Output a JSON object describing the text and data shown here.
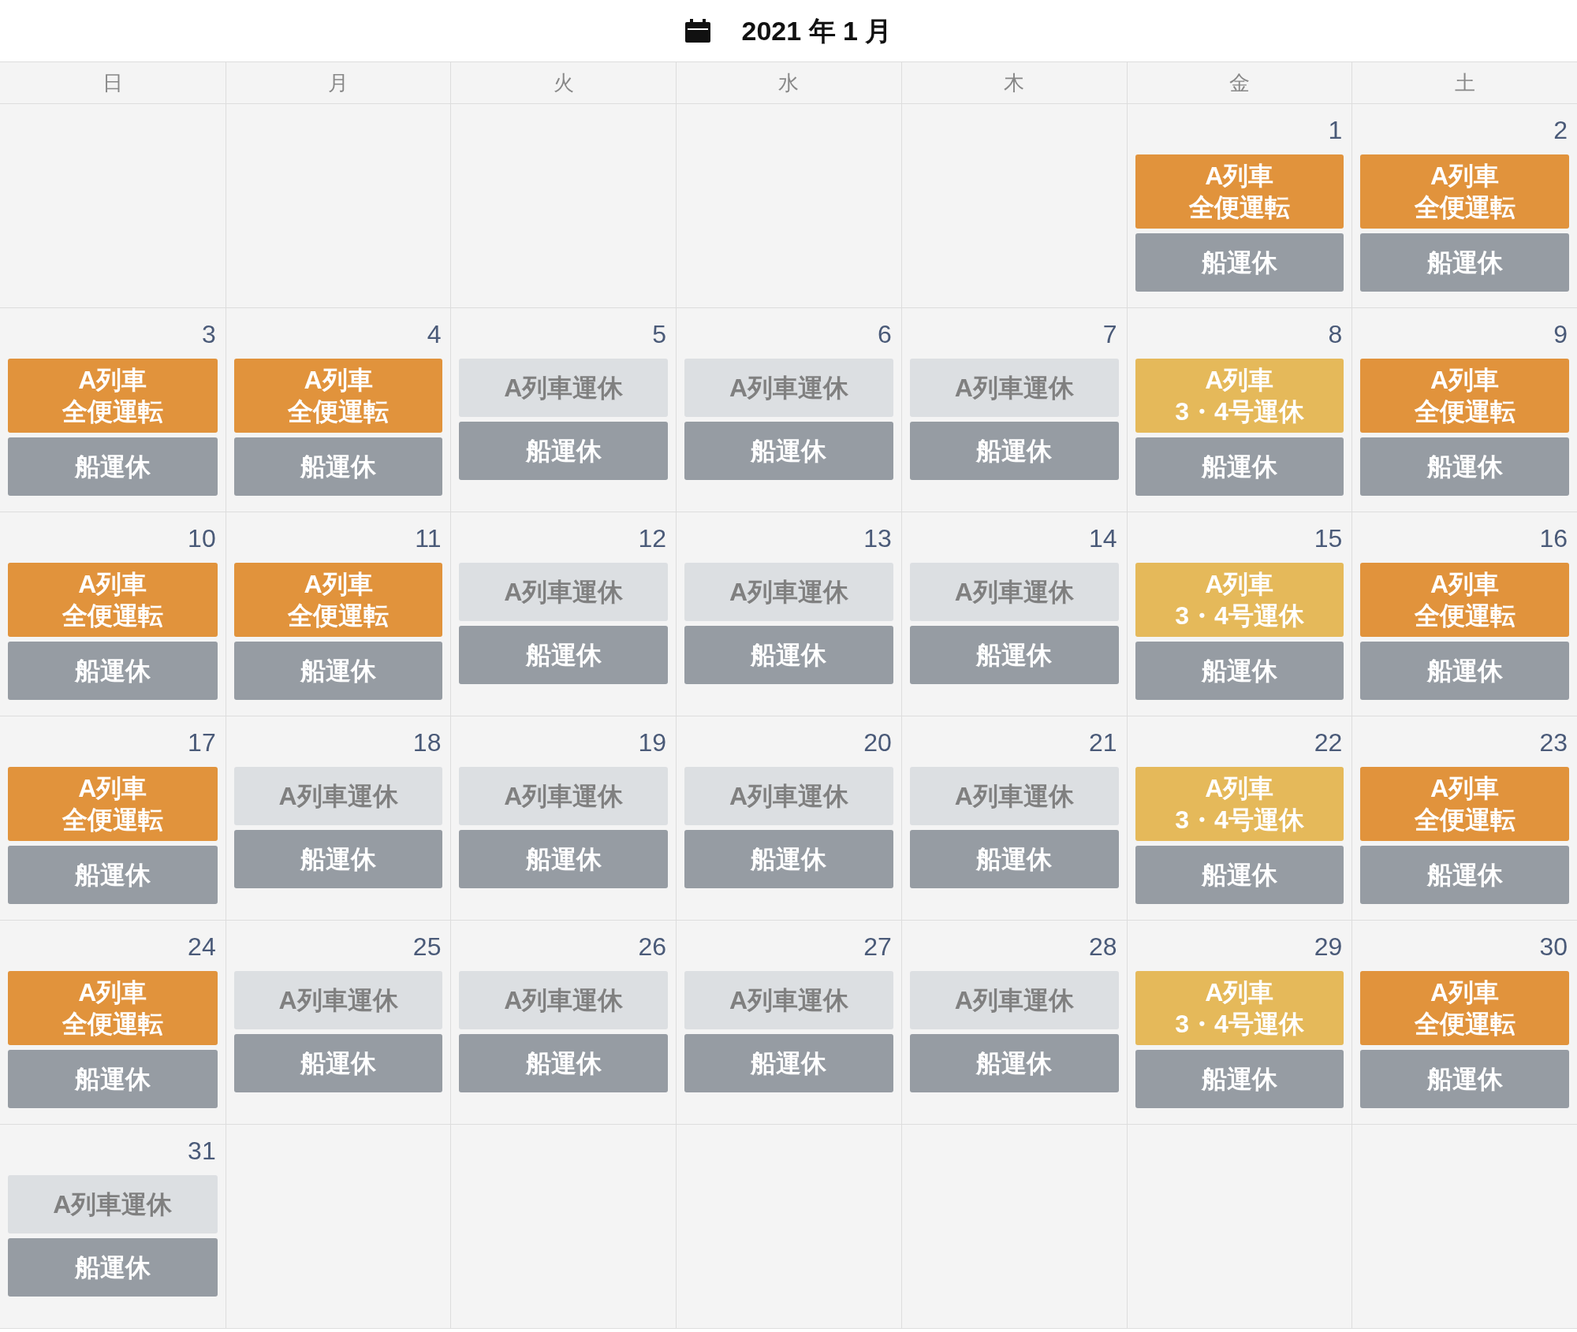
{
  "title": "2021 年 1 月",
  "weekdays": [
    "日",
    "月",
    "火",
    "水",
    "木",
    "金",
    "土"
  ],
  "weeks": [
    {
      "fri": {
        "day": "1",
        "events": [
          {
            "kind": "run",
            "lines": [
              "A列車",
              "全便運転"
            ]
          },
          {
            "kind": "ship",
            "lines": [
              "船運休"
            ]
          }
        ]
      },
      "sat": {
        "day": "2",
        "events": [
          {
            "kind": "run",
            "lines": [
              "A列車",
              "全便運転"
            ]
          },
          {
            "kind": "ship",
            "lines": [
              "船運休"
            ]
          }
        ]
      }
    },
    {
      "sun": {
        "day": "3",
        "events": [
          {
            "kind": "run",
            "lines": [
              "A列車",
              "全便運転"
            ]
          },
          {
            "kind": "ship",
            "lines": [
              "船運休"
            ]
          }
        ]
      },
      "mon": {
        "day": "4",
        "events": [
          {
            "kind": "run",
            "lines": [
              "A列車",
              "全便運転"
            ]
          },
          {
            "kind": "ship",
            "lines": [
              "船運休"
            ]
          }
        ]
      },
      "tue": {
        "day": "5",
        "events": [
          {
            "kind": "halt",
            "lines": [
              "A列車運休"
            ]
          },
          {
            "kind": "ship",
            "lines": [
              "船運休"
            ]
          }
        ]
      },
      "wed": {
        "day": "6",
        "events": [
          {
            "kind": "halt",
            "lines": [
              "A列車運休"
            ]
          },
          {
            "kind": "ship",
            "lines": [
              "船運休"
            ]
          }
        ]
      },
      "thu": {
        "day": "7",
        "events": [
          {
            "kind": "halt",
            "lines": [
              "A列車運休"
            ]
          },
          {
            "kind": "ship",
            "lines": [
              "船運休"
            ]
          }
        ]
      },
      "fri": {
        "day": "8",
        "events": [
          {
            "kind": "partial",
            "lines": [
              "A列車",
              "3・4号運休"
            ]
          },
          {
            "kind": "ship",
            "lines": [
              "船運休"
            ]
          }
        ]
      },
      "sat": {
        "day": "9",
        "events": [
          {
            "kind": "run",
            "lines": [
              "A列車",
              "全便運転"
            ]
          },
          {
            "kind": "ship",
            "lines": [
              "船運休"
            ]
          }
        ]
      }
    },
    {
      "sun": {
        "day": "10",
        "events": [
          {
            "kind": "run",
            "lines": [
              "A列車",
              "全便運転"
            ]
          },
          {
            "kind": "ship",
            "lines": [
              "船運休"
            ]
          }
        ]
      },
      "mon": {
        "day": "11",
        "events": [
          {
            "kind": "run",
            "lines": [
              "A列車",
              "全便運転"
            ]
          },
          {
            "kind": "ship",
            "lines": [
              "船運休"
            ]
          }
        ]
      },
      "tue": {
        "day": "12",
        "events": [
          {
            "kind": "halt",
            "lines": [
              "A列車運休"
            ]
          },
          {
            "kind": "ship",
            "lines": [
              "船運休"
            ]
          }
        ]
      },
      "wed": {
        "day": "13",
        "events": [
          {
            "kind": "halt",
            "lines": [
              "A列車運休"
            ]
          },
          {
            "kind": "ship",
            "lines": [
              "船運休"
            ]
          }
        ]
      },
      "thu": {
        "day": "14",
        "events": [
          {
            "kind": "halt",
            "lines": [
              "A列車運休"
            ]
          },
          {
            "kind": "ship",
            "lines": [
              "船運休"
            ]
          }
        ]
      },
      "fri": {
        "day": "15",
        "events": [
          {
            "kind": "partial",
            "lines": [
              "A列車",
              "3・4号運休"
            ]
          },
          {
            "kind": "ship",
            "lines": [
              "船運休"
            ]
          }
        ]
      },
      "sat": {
        "day": "16",
        "events": [
          {
            "kind": "run",
            "lines": [
              "A列車",
              "全便運転"
            ]
          },
          {
            "kind": "ship",
            "lines": [
              "船運休"
            ]
          }
        ]
      }
    },
    {
      "sun": {
        "day": "17",
        "events": [
          {
            "kind": "run",
            "lines": [
              "A列車",
              "全便運転"
            ]
          },
          {
            "kind": "ship",
            "lines": [
              "船運休"
            ]
          }
        ]
      },
      "mon": {
        "day": "18",
        "events": [
          {
            "kind": "halt",
            "lines": [
              "A列車運休"
            ]
          },
          {
            "kind": "ship",
            "lines": [
              "船運休"
            ]
          }
        ]
      },
      "tue": {
        "day": "19",
        "events": [
          {
            "kind": "halt",
            "lines": [
              "A列車運休"
            ]
          },
          {
            "kind": "ship",
            "lines": [
              "船運休"
            ]
          }
        ]
      },
      "wed": {
        "day": "20",
        "events": [
          {
            "kind": "halt",
            "lines": [
              "A列車運休"
            ]
          },
          {
            "kind": "ship",
            "lines": [
              "船運休"
            ]
          }
        ]
      },
      "thu": {
        "day": "21",
        "events": [
          {
            "kind": "halt",
            "lines": [
              "A列車運休"
            ]
          },
          {
            "kind": "ship",
            "lines": [
              "船運休"
            ]
          }
        ]
      },
      "fri": {
        "day": "22",
        "events": [
          {
            "kind": "partial",
            "lines": [
              "A列車",
              "3・4号運休"
            ]
          },
          {
            "kind": "ship",
            "lines": [
              "船運休"
            ]
          }
        ]
      },
      "sat": {
        "day": "23",
        "events": [
          {
            "kind": "run",
            "lines": [
              "A列車",
              "全便運転"
            ]
          },
          {
            "kind": "ship",
            "lines": [
              "船運休"
            ]
          }
        ]
      }
    },
    {
      "sun": {
        "day": "24",
        "events": [
          {
            "kind": "run",
            "lines": [
              "A列車",
              "全便運転"
            ]
          },
          {
            "kind": "ship",
            "lines": [
              "船運休"
            ]
          }
        ]
      },
      "mon": {
        "day": "25",
        "events": [
          {
            "kind": "halt",
            "lines": [
              "A列車運休"
            ]
          },
          {
            "kind": "ship",
            "lines": [
              "船運休"
            ]
          }
        ]
      },
      "tue": {
        "day": "26",
        "events": [
          {
            "kind": "halt",
            "lines": [
              "A列車運休"
            ]
          },
          {
            "kind": "ship",
            "lines": [
              "船運休"
            ]
          }
        ]
      },
      "wed": {
        "day": "27",
        "events": [
          {
            "kind": "halt",
            "lines": [
              "A列車運休"
            ]
          },
          {
            "kind": "ship",
            "lines": [
              "船運休"
            ]
          }
        ]
      },
      "thu": {
        "day": "28",
        "events": [
          {
            "kind": "halt",
            "lines": [
              "A列車運休"
            ]
          },
          {
            "kind": "ship",
            "lines": [
              "船運休"
            ]
          }
        ]
      },
      "fri": {
        "day": "29",
        "events": [
          {
            "kind": "partial",
            "lines": [
              "A列車",
              "3・4号運休"
            ]
          },
          {
            "kind": "ship",
            "lines": [
              "船運休"
            ]
          }
        ]
      },
      "sat": {
        "day": "30",
        "events": [
          {
            "kind": "run",
            "lines": [
              "A列車",
              "全便運転"
            ]
          },
          {
            "kind": "ship",
            "lines": [
              "船運休"
            ]
          }
        ]
      }
    },
    {
      "sun": {
        "day": "31",
        "events": [
          {
            "kind": "halt",
            "lines": [
              "A列車運休"
            ]
          },
          {
            "kind": "ship",
            "lines": [
              "船運休"
            ]
          }
        ]
      }
    }
  ]
}
